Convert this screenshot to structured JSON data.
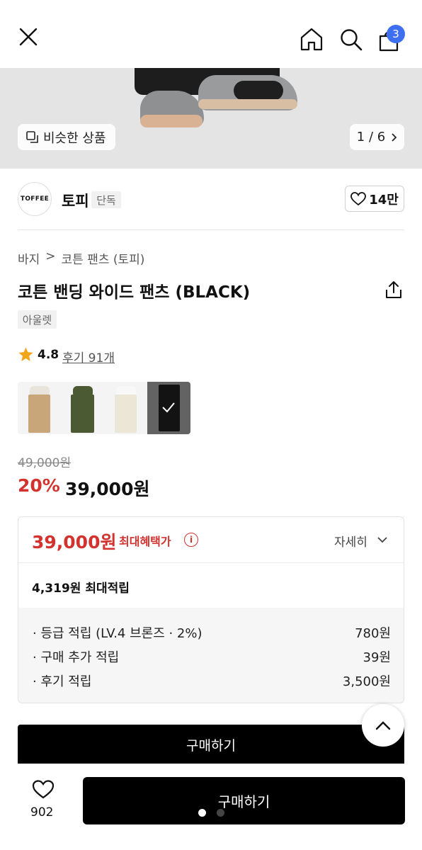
{
  "header": {
    "cart_count": "3"
  },
  "hero": {
    "similar_label": "비슷한 상품",
    "page_counter": "1 / 6"
  },
  "brand": {
    "logo_text": "TOFFEE",
    "name": "토피",
    "exclusive_tag": "단독",
    "like_count": "14만"
  },
  "product": {
    "breadcrumb_category": "바지",
    "breadcrumb_separator": ">",
    "breadcrumb_sub": "코튼 팬츠 (토피)",
    "title": "코튼 밴딩 와이드 팬츠 (BLACK)",
    "outlet_tag": "아울렛",
    "rating": "4.8",
    "reviews_link": "후기 91개",
    "swatches": [
      {
        "name": "beige",
        "color": "#c9a67a"
      },
      {
        "name": "khaki",
        "color": "#4b5a32"
      },
      {
        "name": "ivory",
        "color": "#ece6d6"
      },
      {
        "name": "black",
        "color": "#1b1b1b",
        "selected": true
      }
    ],
    "original_price": "49,000원",
    "discount_rate": "20%",
    "sale_price": "39,000원"
  },
  "benefit": {
    "max_price": "39,000원",
    "max_label": "최대혜택가",
    "info_icon": "i",
    "detail_label": "자세히",
    "points_total": "4,319원 최대적립",
    "rows": [
      {
        "label": "· 등급 적립 (LV.4 브론즈 · 2%)",
        "value": "780원"
      },
      {
        "label": "· 구매 추가 적립",
        "value": "39원"
      },
      {
        "label": "· 후기 적립",
        "value": "3,500원"
      }
    ]
  },
  "actions": {
    "buy_label_inline": "구매하기",
    "buy_label": "구매하기",
    "wishlist_count": "902"
  },
  "colors": {
    "accent_red": "#d2332f",
    "cart_badge": "#3e6ff0",
    "star": "#f2a51a"
  }
}
